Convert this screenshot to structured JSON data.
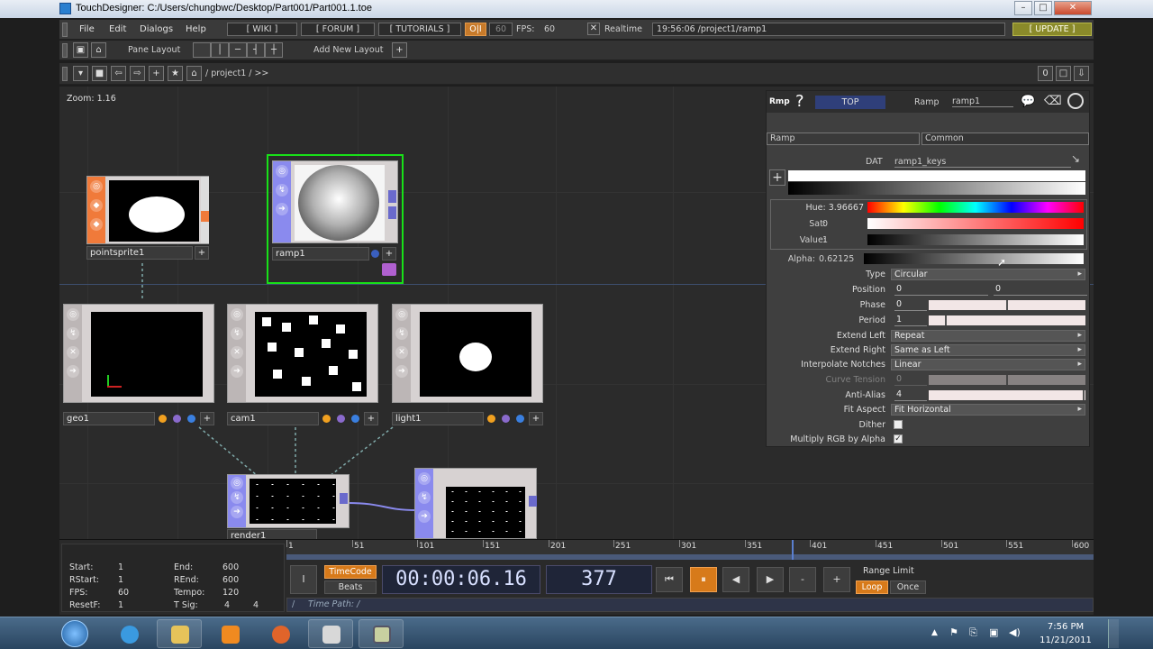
{
  "window": {
    "title": "TouchDesigner: C:/Users/chungbwc/Desktop/Part001/Part001.1.toe"
  },
  "menu": {
    "items": [
      "File",
      "Edit",
      "Dialogs",
      "Help"
    ],
    "wiki": "[ WIKI ]",
    "forum": "[ FORUM ]",
    "tutorials": "[ TUTORIALS ]",
    "oi": "O|I",
    "fps_value_box": "60",
    "fps_label": "FPS:",
    "fps_value": "60",
    "realtime": "Realtime",
    "clock_path": "19:56:06 /project1/ramp1",
    "update": "[ UPDATE ]"
  },
  "panebar": {
    "pane_layout": "Pane Layout",
    "add_new_layout": "Add New Layout"
  },
  "pathbar": {
    "path": "/ project1 / >>",
    "right_count": "0"
  },
  "network": {
    "zoom": "Zoom: 1.16",
    "nodes": {
      "pointsprite": "pointsprite1",
      "ramp": "ramp1",
      "geo": "geo1",
      "cam": "cam1",
      "light": "light1",
      "render": "render1"
    }
  },
  "params": {
    "op_short": "Rmp",
    "op_family": "TOP",
    "op_type": "Ramp",
    "op_name": "ramp1",
    "tabs": [
      "Ramp",
      "Common"
    ],
    "dat_label": "DAT",
    "dat_value": "ramp1_keys",
    "hue_label": "Hue:",
    "hue_value": "3.96667",
    "sat_label": "Sat:",
    "sat_value": "0",
    "value_label": "Value:",
    "value_value": "1",
    "alpha_label": "Alpha:",
    "alpha_value": "0.62125",
    "rows": {
      "type": {
        "label": "Type",
        "value": "Circular"
      },
      "position": {
        "label": "Position",
        "v1": "0",
        "v2": "0"
      },
      "phase": {
        "label": "Phase",
        "value": "0"
      },
      "period": {
        "label": "Period",
        "value": "1"
      },
      "extend_left": {
        "label": "Extend Left",
        "value": "Repeat"
      },
      "extend_right": {
        "label": "Extend Right",
        "value": "Same as Left"
      },
      "interp": {
        "label": "Interpolate Notches",
        "value": "Linear"
      },
      "curve_tension": {
        "label": "Curve Tension",
        "value": "0"
      },
      "anti_alias": {
        "label": "Anti-Alias",
        "value": "4"
      },
      "fit_aspect": {
        "label": "Fit Aspect",
        "value": "Fit Horizontal"
      },
      "dither": {
        "label": "Dither"
      },
      "multiply": {
        "label": "Multiply RGB by Alpha"
      }
    }
  },
  "timeline": {
    "ticks": [
      "1",
      "51",
      "101",
      "151",
      "201",
      "251",
      "301",
      "351",
      "401",
      "451",
      "501",
      "551",
      "600"
    ],
    "start_label": "Start:",
    "start": "1",
    "end_label": "End:",
    "end": "600",
    "rstart_label": "RStart:",
    "rstart": "1",
    "rend_label": "REnd:",
    "rend": "600",
    "fps_label": "FPS:",
    "fps": "60",
    "tempo_label": "Tempo:",
    "tempo": "120",
    "resetf_label": "ResetF:",
    "resetf": "1",
    "tsig_label": "T Sig:",
    "tsig1": "4",
    "tsig2": "4",
    "i_button": "I",
    "timecode": "TimeCode",
    "beats": "Beats",
    "time": "00:00:06.16",
    "frame": "377",
    "minus": "-",
    "plus": "+",
    "range_limit": "Range Limit",
    "loop": "Loop",
    "once": "Once",
    "slash": "/",
    "time_path": "Time Path: /"
  },
  "taskbar": {
    "time": "7:56 PM",
    "date": "11/21/2011"
  }
}
